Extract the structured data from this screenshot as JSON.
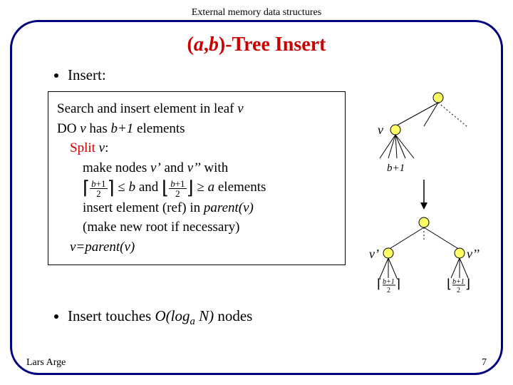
{
  "header": "External memory data structures",
  "title_a": "(",
  "title_ital1": "a",
  "title_comma": ",",
  "title_ital2": "b",
  "title_b": ")-Tree Insert",
  "bullet1": "Insert:",
  "algo": {
    "l1a": "Search and insert element in leaf ",
    "l1v": "v",
    "l2a": "DO ",
    "l2v": "v",
    "l2b": " has ",
    "l2exp": "b+1",
    "l2c": " elements",
    "l3a": "Split ",
    "l3b": ":",
    "l4a": "make nodes ",
    "l4v1": "v’",
    "l4b": " and ",
    "l4v2": "v’’",
    "l4c": " with",
    "l5mid": " and ",
    "l5tail": " elements",
    "l5b": "b",
    "l5a": "a",
    "l6a": "insert element (ref) in ",
    "l6p": "parent(v)",
    "l7": "(make new root if necessary)",
    "l8a": "v=parent(v)"
  },
  "bullet2a": "Insert touches ",
  "bullet2b": " nodes",
  "complexity": "O(log",
  "complexity_sub": "a",
  "complexity_tail": " N)",
  "diag": {
    "v": "v",
    "vp": "v’",
    "vpp": "v’’",
    "bp1": "b+1"
  },
  "footer_left": "Lars Arge",
  "footer_right": "7",
  "chart_data": {
    "type": "table",
    "title": "(a,b)-Tree Insert algorithm pseudocode and split diagram",
    "notes": "Slide shows node v with b+1 children splitting into v' with ⌈(b+1)/2⌉ children and v'' with ⌊(b+1)/2⌋ children; complexity O(log_a N)"
  }
}
